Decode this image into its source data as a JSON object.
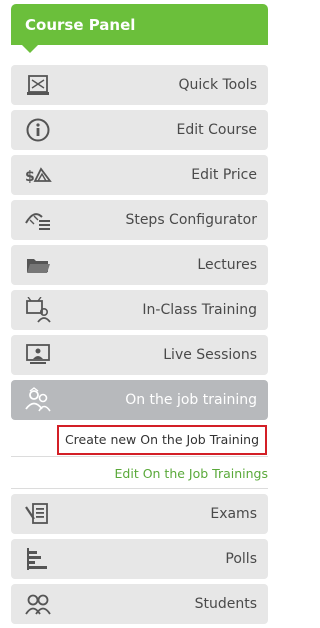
{
  "panel": {
    "title": "Course Panel",
    "accent": "#6bbf3b"
  },
  "menu": [
    {
      "label": "Quick Tools",
      "icon": "quick-tools-icon"
    },
    {
      "label": "Edit Course",
      "icon": "info-icon"
    },
    {
      "label": "Edit Price",
      "icon": "price-icon"
    },
    {
      "label": "Steps Configurator",
      "icon": "steps-icon"
    },
    {
      "label": "Lectures",
      "icon": "folder-icon"
    },
    {
      "label": "In-Class Training",
      "icon": "classroom-icon"
    },
    {
      "label": "Live Sessions",
      "icon": "monitor-icon"
    },
    {
      "label": "On the job training",
      "icon": "users-icon",
      "active": true
    },
    {
      "label": "Exams",
      "icon": "exam-icon"
    },
    {
      "label": "Polls",
      "icon": "polls-icon"
    },
    {
      "label": "Students",
      "icon": "students-icon"
    }
  ],
  "submenu": {
    "create_label": "Create new On the Job Training",
    "edit_label": "Edit On the Job Trainings",
    "edit_color": "#5aa93a"
  }
}
